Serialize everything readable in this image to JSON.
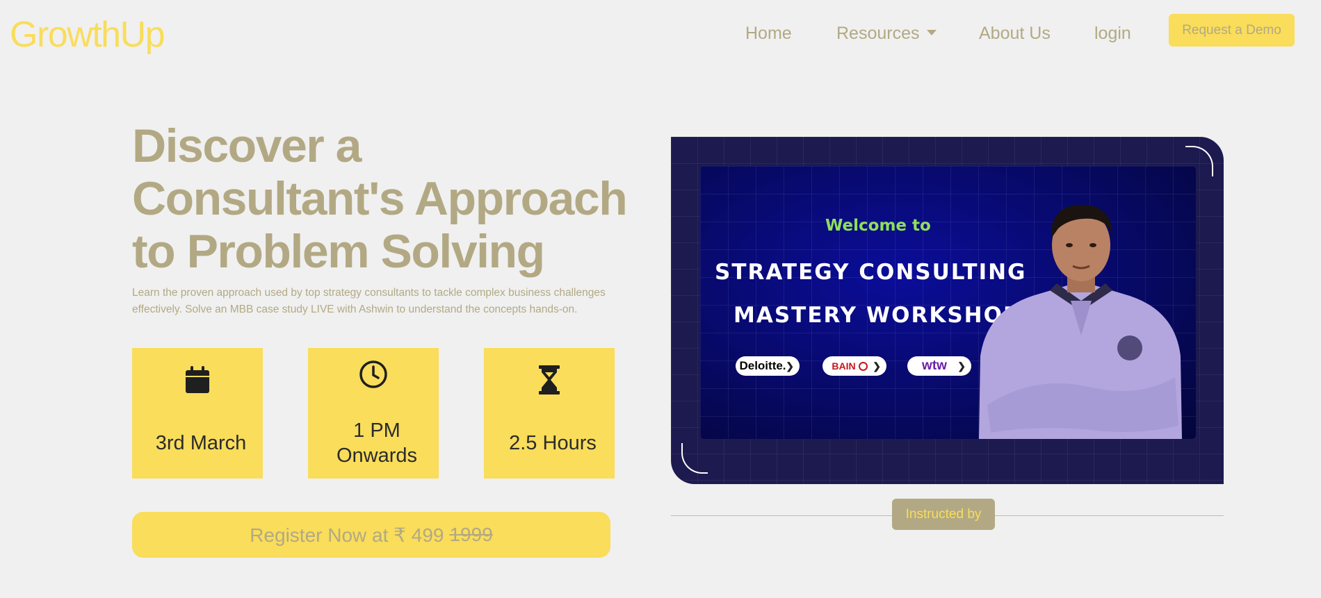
{
  "nav": {
    "brand": "GrowthUp",
    "home": "Home",
    "resources": "Resources",
    "about": "About Us",
    "login": "login",
    "demo": "Request a Demo"
  },
  "hero": {
    "title": "Discover a Consultant's Approach to Problem Solving",
    "description": "Learn the proven approach used by top strategy consultants to tackle complex business challenges effectively. Solve an MBB case study LIVE with Ashwin to understand the concepts hands-on.",
    "cards": [
      {
        "icon": "calendar-icon",
        "label": "3rd March"
      },
      {
        "icon": "clock-icon",
        "label": "1 PM Onwards"
      },
      {
        "icon": "hourglass-icon",
        "label": "2.5 Hours"
      }
    ],
    "register_prefix": "Register Now at ₹ 499",
    "register_old_price": "1999"
  },
  "promo": {
    "welcome": "Welcome to",
    "line1": "STRATEGY CONSULTING",
    "line2": "MASTERY WORKSHOP",
    "logos": [
      "Deloitte.",
      "BAIN",
      "wtw"
    ],
    "instructed_by": "Instructed by"
  },
  "colors": {
    "accent": "#f9dd5b",
    "muted_text": "#b2a984",
    "background": "#f0f0f0",
    "promo_bg": "#1d1a4f",
    "welcome_green": "#8fe05a"
  }
}
